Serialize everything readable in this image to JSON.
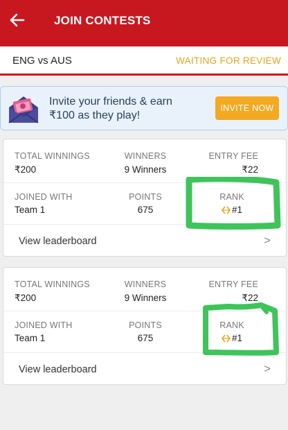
{
  "header": {
    "title": "JOIN CONTESTS",
    "colors": {
      "bar": "#c8181f",
      "text": "#ffffff"
    }
  },
  "match": {
    "name": "ENG vs AUS",
    "status": "WAITING FOR REVIEW",
    "status_color": "#e8a21c"
  },
  "invite": {
    "line1": "Invite your friends & earn",
    "line2": "₹100 as they play!",
    "button_label": "INVITE NOW",
    "button_color": "#f4a922"
  },
  "contests": [
    {
      "total_winnings_label": "TOTAL WINNINGS",
      "total_winnings": "₹200",
      "winners_label": "WINNERS",
      "winners": "9 Winners",
      "entry_fee_label": "ENTRY FEE",
      "entry_fee": "₹22",
      "joined_with_label": "JOINED WITH",
      "joined_with": "Team 1",
      "points_label": "POINTS",
      "points": "675",
      "rank_label": "RANK",
      "rank": "#1",
      "leaderboard_label": "View leaderboard",
      "chevron": ">"
    },
    {
      "total_winnings_label": "TOTAL WINNINGS",
      "total_winnings": "₹200",
      "winners_label": "WINNERS",
      "winners": "9 Winners",
      "entry_fee_label": "ENTRY FEE",
      "entry_fee": "₹22",
      "joined_with_label": "JOINED WITH",
      "joined_with": "Team 1",
      "points_label": "POINTS",
      "points": "675",
      "rank_label": "RANK",
      "rank": "#1",
      "leaderboard_label": "View leaderboard",
      "chevron": ">"
    }
  ],
  "annotation_color": "#3ec45a"
}
